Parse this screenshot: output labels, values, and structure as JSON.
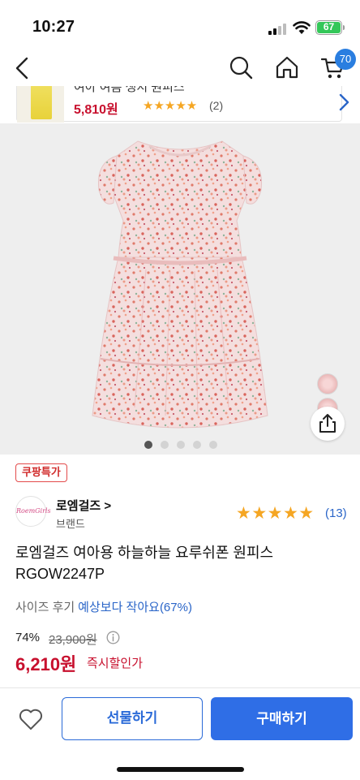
{
  "status_bar": {
    "time": "10:27",
    "battery": "67"
  },
  "nav": {
    "cart_count": "70",
    "icons": [
      "chevron-left-icon",
      "search-icon",
      "home-icon",
      "cart-icon"
    ]
  },
  "recommendation": {
    "title": "여아 여름 생지 원피스",
    "price": "5,810원",
    "stars": "★★★★★",
    "review_count": "(2)"
  },
  "product_image": {
    "page_dots": 5,
    "active_dot": 0
  },
  "product": {
    "deal_badge": "쿠팡특가",
    "brand": {
      "logo_text": "RoemGirls",
      "name": "로엠걸즈 >",
      "sub": "브랜드",
      "stars": "★★★★★",
      "review_count": "(13)"
    },
    "title_line1": "로엠걸즈 여아용 하늘하늘 요루쉬폰 원피스",
    "title_line2": "RGOW2247P",
    "size_review": {
      "label": "사이즈 후기",
      "value": "예상보다 작아요(67%)"
    },
    "price": {
      "discount": "74%",
      "original": "23,900원",
      "sale": "6,210원",
      "sale_label": "즉시할인가"
    }
  },
  "bottom_bar": {
    "gift_label": "선물하기",
    "buy_label": "구매하기"
  },
  "colors": {
    "accent_blue": "#2f6ee6",
    "price_red": "#c8102e",
    "star_yellow": "#f5a623"
  }
}
